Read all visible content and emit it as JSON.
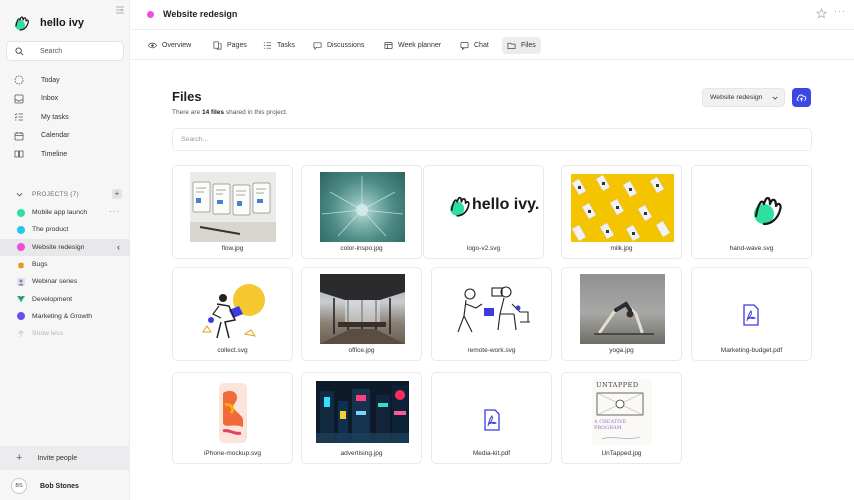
{
  "app": {
    "name": "hello ivy"
  },
  "sidebar": {
    "search_label": "Search",
    "nav": [
      {
        "label": "Today",
        "icon": "today-icon"
      },
      {
        "label": "Inbox",
        "icon": "inbox-icon"
      },
      {
        "label": "My tasks",
        "icon": "tasks-icon"
      },
      {
        "label": "Calendar",
        "icon": "calendar-icon"
      },
      {
        "label": "Timeline",
        "icon": "timeline-icon"
      }
    ],
    "projects_header": "PROJECTS (7)",
    "projects": [
      {
        "label": "Mobile app launch",
        "color": "#2ee0a0"
      },
      {
        "label": "The product",
        "color": "#22c7ee"
      },
      {
        "label": "Website redesign",
        "color": "#ee4fd8"
      },
      {
        "label": "Bugs",
        "color": "#f0a020"
      },
      {
        "label": "Webinar series",
        "color": "#8a7fa8"
      },
      {
        "label": "Development",
        "color": "#2fbf8a"
      },
      {
        "label": "Marketing & Growth",
        "color": "#6c4ef0"
      },
      {
        "label": "Show less",
        "color": "#c8c8cc"
      }
    ],
    "invite_label": "Invite people",
    "user": {
      "initials": "BS",
      "name": "Bob Stones"
    }
  },
  "header": {
    "project_title": "Website redesign",
    "project_color": "#ee4fd8"
  },
  "tabs": [
    {
      "label": "Overview",
      "icon": "eye-icon"
    },
    {
      "label": "Pages",
      "icon": "pages-icon"
    },
    {
      "label": "Tasks",
      "icon": "tasks-icon"
    },
    {
      "label": "Discussions",
      "icon": "chat-bubble-icon"
    },
    {
      "label": "Week planner",
      "icon": "planner-icon"
    },
    {
      "label": "Chat",
      "icon": "chat-icon"
    },
    {
      "label": "Files",
      "icon": "files-icon"
    }
  ],
  "main": {
    "title": "Files",
    "subtitle_prefix": "There are ",
    "subtitle_count": "14 files",
    "subtitle_suffix": " shared in this project.",
    "project_select": "Website redesign",
    "search_placeholder": "Search...",
    "files": [
      {
        "name": "flow.jpg"
      },
      {
        "name": "color-inspo.jpg"
      },
      {
        "name": "logo-v2.svg",
        "logo_text": "hello ivy."
      },
      {
        "name": "milk.jpg"
      },
      {
        "name": "hand-wave.svg"
      },
      {
        "name": "collect.svg"
      },
      {
        "name": "office.jpg"
      },
      {
        "name": "remote-work.svg"
      },
      {
        "name": "yoga.jpg"
      },
      {
        "name": "Marketing-budget.pdf"
      },
      {
        "name": "iPhone-mockup.svg"
      },
      {
        "name": "advertising.jpg"
      },
      {
        "name": "Media-kit.pdf"
      },
      {
        "name": "UnTapped.jpg",
        "sketch_text_top": "UNTAPPED",
        "sketch_text_bottom": "A CREATIVE PROGRAM"
      }
    ]
  }
}
